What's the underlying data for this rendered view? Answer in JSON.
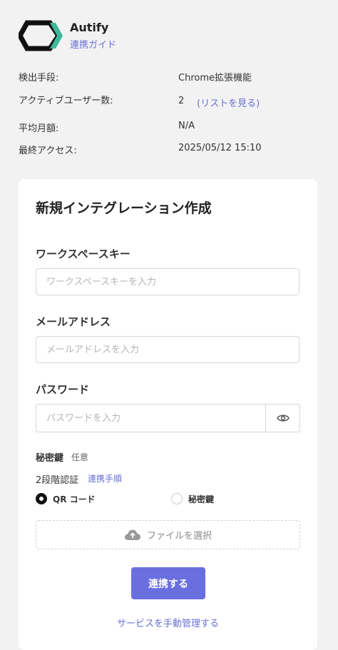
{
  "app": {
    "name": "Autify",
    "guide_link": "連携ガイド",
    "logo_colors": {
      "dark": "#111111",
      "accent": "#3db89a"
    }
  },
  "info": {
    "detection_label": "検出手段:",
    "detection_value": "Chrome拡張機能",
    "active_users_label": "アクティブユーザー数:",
    "active_users_value": "2",
    "active_users_link": "(リストを見る)",
    "avg_monthly_label": "平均月額:",
    "avg_monthly_value": "N/A",
    "last_access_label": "最終アクセス:",
    "last_access_value": "2025/05/12 15:10"
  },
  "form": {
    "title": "新規インテグレーション作成",
    "workspace_key": {
      "label": "ワークスペースキー",
      "placeholder": "ワークスペースキーを入力",
      "value": ""
    },
    "email": {
      "label": "メールアドレス",
      "placeholder": "メールアドレスを入力",
      "value": ""
    },
    "password": {
      "label": "パスワード",
      "placeholder": "パスワードを入力",
      "value": ""
    },
    "secret_key": {
      "label": "秘密鍵",
      "optional": "任意"
    },
    "two_factor": {
      "label": "2段階認証",
      "link": "連携手順",
      "options": [
        {
          "label": "QR コード",
          "selected": true
        },
        {
          "label": "秘密鍵",
          "selected": false
        }
      ]
    },
    "file_button": "ファイルを選択",
    "submit_label": "連携する",
    "manual_link": "サービスを手動管理する"
  },
  "colors": {
    "accent": "#6a6fe0",
    "link": "#6a6fd6",
    "background": "#f2f2f2"
  }
}
